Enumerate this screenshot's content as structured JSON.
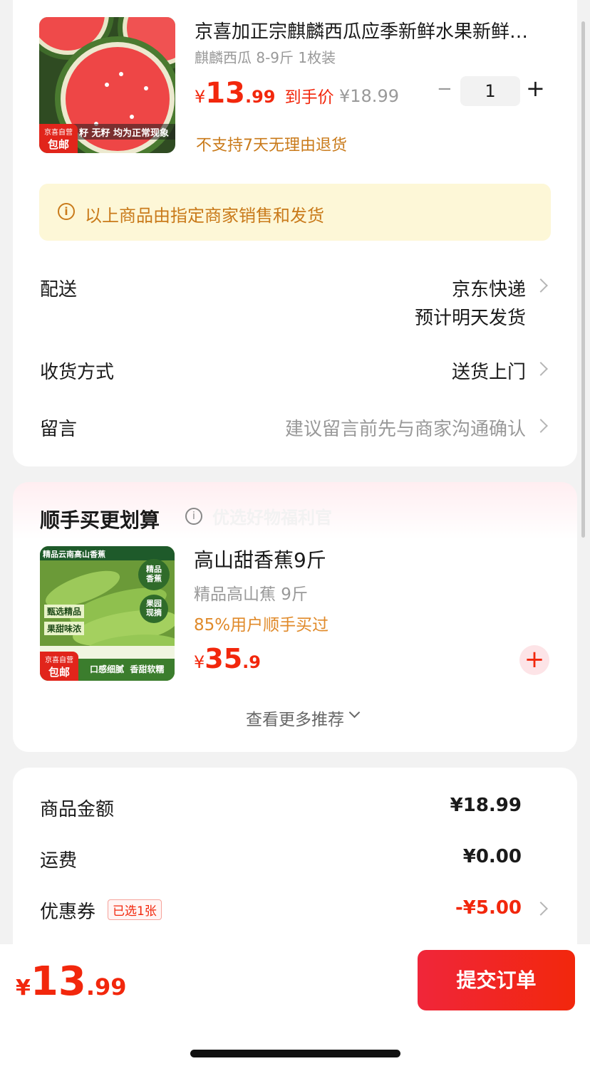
{
  "product": {
    "title": "京喜加正宗麒麟西瓜应季新鲜水果新鲜…",
    "spec": "麒麟西瓜 8-9斤 1枚装",
    "image_caption": "籽 无籽 均为正常现象",
    "badge_top": "京喜自营",
    "badge_bottom": "包邮",
    "price_currency": "¥",
    "price_int": "13",
    "price_dec": ".99",
    "price_label": "到手价",
    "original_price": "¥18.99",
    "quantity": "1",
    "minus": "−",
    "plus": "+",
    "return_note": "不支持7天无理由退货"
  },
  "notice": {
    "text": "以上商品由指定商家销售和发货"
  },
  "delivery": {
    "label": "配送",
    "value_line1": "京东快递",
    "value_line2": "预计明天发货"
  },
  "receive": {
    "label": "收货方式",
    "value": "送货上门"
  },
  "message": {
    "label": "留言",
    "placeholder": "建议留言前先与商家沟通确认"
  },
  "recommend": {
    "title": "顺手买更划算",
    "watermark": "优选好物福利官",
    "item": {
      "title": "高山甜香蕉9斤",
      "spec": "精品高山蕉 9斤",
      "social": "85%用户顺手买过",
      "price_currency": "¥",
      "price_int": "35",
      "price_dec": ".9",
      "image_header": "精品云南高山香蕉",
      "image_tag1": "甄选精品",
      "image_tag2": "果甜味浓",
      "image_stamp1": "精品香蕉",
      "image_stamp2": "果园现摘",
      "image_footer": "口感细腻  香甜软糯",
      "badge_top": "京喜自营",
      "badge_bottom": "包邮"
    },
    "more": "查看更多推荐"
  },
  "summary": {
    "goods_label": "商品金额",
    "goods_value": "¥18.99",
    "shipping_label": "运费",
    "shipping_value": "¥0.00",
    "coupon_label": "优惠券",
    "coupon_tag": "已选1张",
    "coupon_value": "-¥5.00"
  },
  "bottom": {
    "currency": "¥",
    "total_int": "13",
    "total_dec": ".99",
    "submit": "提交订单"
  },
  "colors": {
    "accent": "#f2270c",
    "orange": "#c97a1a",
    "notice_bg": "#fdf7d7",
    "submit_bg": "#f0263a"
  }
}
